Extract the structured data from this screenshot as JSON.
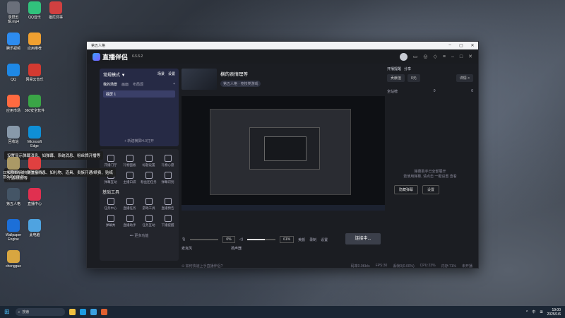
{
  "window": {
    "title": "第五人格"
  },
  "desktop_icons": [
    {
      "label": "录屏剪辑.mp4",
      "color": "#6a6f7a"
    },
    {
      "label": "QQ音乐",
      "color": "#31c27c"
    },
    {
      "label": "楹厄洞事",
      "color": "#d04040"
    },
    {
      "label": "腾讯视频",
      "color": "#2d8cf0"
    },
    {
      "label": "应用推荐",
      "color": "#f0a030"
    },
    {
      "label": "QQ",
      "color": "#1e88e5"
    },
    {
      "label": "网易云音乐",
      "color": "#d33a31"
    },
    {
      "label": "应用市场",
      "color": "#ff6a40"
    },
    {
      "label": "360安全软件",
      "color": "#3aa546"
    },
    {
      "label": "回收站",
      "color": "#8899aa"
    },
    {
      "label": "Microsoft Edge",
      "color": "#0f8fd6"
    },
    {
      "label": "日常思维传统意外的创新的",
      "color": "#aa9966"
    },
    {
      "label": "元素直播中心",
      "color": "#e04040"
    },
    {
      "label": "第五人格",
      "color": "#445566"
    },
    {
      "label": "直播中心",
      "color": "#e03050"
    },
    {
      "label": "Wallpaper Engine",
      "color": "#1c6fd8"
    },
    {
      "label": "此电脑",
      "color": "#4fa3e0"
    },
    {
      "label": "chengguo",
      "color": "#d8a640"
    }
  ],
  "app": {
    "name": "直播伴侣",
    "version": "6.5.5.2",
    "mode": "常规模式 ▼",
    "mode_links": [
      "场景",
      "设置"
    ],
    "tabs": [
      "我的场景",
      "画面",
      "布局源"
    ],
    "scene": "截屏 1",
    "add_scene": "+ 新建横屏H.0打开",
    "tooltips": [
      "设置显示弹幕消息、如弹幕、系统消息、粉丝牌开播等",
      "设置显示礼物弹窗消息、如礼物、道具、贵族开通/续费、贴纸",
      "开通/续费等"
    ],
    "tools_a": [
      "开播门厅",
      "礼物面板",
      "标题设置",
      "礼物心愿",
      "弹幕互动",
      "主播口袋",
      "粉丝团任务",
      "弹幕识别"
    ],
    "section_basic": "基础工具",
    "tools_b": [
      "任务中心",
      "直播任务",
      "游戏工具",
      "直播预告",
      "弹幕秀",
      "直播助手",
      "任务互动",
      "下播提醒"
    ],
    "more": "••• 更多功能",
    "source_title": "横的表情理等",
    "source_tags": [
      "第五人格 · 竞技类游戏"
    ],
    "volume_label": "麦克风",
    "volume_value": "0%",
    "speaker_label": "扬声器",
    "speaker_value": "61%",
    "ctrl_labels": [
      "美颜",
      "录制",
      "设置"
    ],
    "live_button": "连接中...",
    "right_tabs": [
      "贡献值",
      "0元"
    ],
    "right_actions": [
      "开播提醒",
      "分享",
      "详情 >"
    ],
    "right_stats": [
      "全站榜",
      "0",
      "0"
    ],
    "danmu_lines": [
      "弹幕助手已全部展开",
      "若使用弹幕, 请点击 一键设置 查看"
    ],
    "right_buttons": [
      "隐藏弹幕",
      "设置"
    ],
    "status_left": "⊙ 如何快速上手直播伴侣?",
    "status_right": [
      "码率0.0Kb/s",
      "FPS:30",
      "丢帧0(0.00%)",
      "CPU:23%",
      "内存:71%",
      "未开播"
    ]
  },
  "taskbar": {
    "search": "搜索",
    "time": "19:00",
    "date": "2025/1/6",
    "tray": [
      "^",
      "中",
      "⊞"
    ]
  }
}
